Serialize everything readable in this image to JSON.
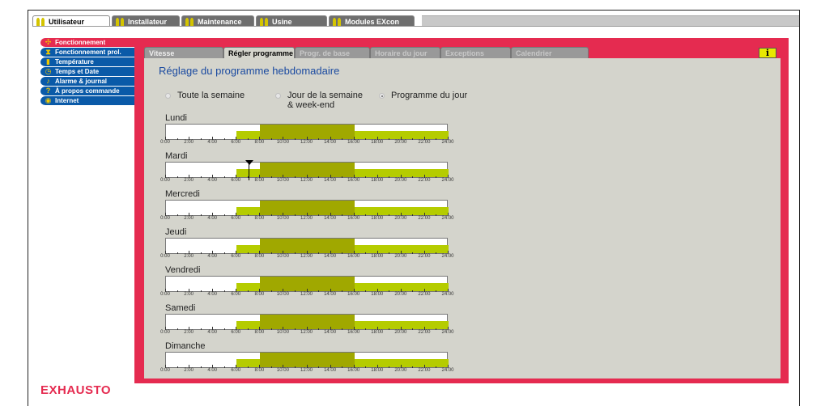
{
  "top_tabs": [
    {
      "label": "Utilisateur",
      "active": true,
      "width": 96,
      "icon": "user-icon"
    },
    {
      "label": "Installateur",
      "active": false,
      "width": 84,
      "icon": "installer-icon"
    },
    {
      "label": "Maintenance",
      "active": false,
      "width": 90,
      "icon": "maintenance-icon"
    },
    {
      "label": "Usine",
      "active": false,
      "width": 88,
      "icon": "factory-icon"
    },
    {
      "label": "Modules EXcon",
      "active": false,
      "width": 106,
      "icon": "modules-icon"
    }
  ],
  "nav": [
    {
      "label": "Fonctionnement",
      "active": true,
      "icon": "fan-icon"
    },
    {
      "label": "Fonctionnement prol.",
      "active": false,
      "icon": "hourglass-icon"
    },
    {
      "label": "Température",
      "active": false,
      "icon": "thermometer-icon"
    },
    {
      "label": "Temps et Date",
      "active": false,
      "icon": "clock-icon"
    },
    {
      "label": "Alarme & journal",
      "active": false,
      "icon": "bell-icon"
    },
    {
      "label": "À propos commande",
      "active": false,
      "icon": "question-icon"
    },
    {
      "label": "Internet",
      "active": false,
      "icon": "globe-icon"
    }
  ],
  "sub_tabs": [
    {
      "label": "Vitesse",
      "active": false,
      "enabled": true
    },
    {
      "label": "Régler programme",
      "active": true,
      "enabled": true
    },
    {
      "label": "Progr. de base",
      "active": false,
      "enabled": false
    },
    {
      "label": "Horaire du jour",
      "active": false,
      "enabled": false
    },
    {
      "label": "Exceptions",
      "active": false,
      "enabled": false
    },
    {
      "label": "Calendrier",
      "active": false,
      "enabled": false
    }
  ],
  "info_label": "i",
  "title": "Réglage du programme hebdomadaire",
  "radios": [
    {
      "label": "Toute la semaine",
      "label2": "",
      "checked": false
    },
    {
      "label": "Jour de la semaine",
      "label2": "& week-end",
      "checked": false
    },
    {
      "label": "Programme du jour",
      "label2": "",
      "checked": true
    }
  ],
  "colors": {
    "level1": "#b5cc00",
    "level2": "#a0a800",
    "accent": "#e52b50",
    "nav": "#0a5aa8"
  },
  "time_labels": [
    "0:00",
    "2:00",
    "4:00",
    "6:00",
    "8:00",
    "10:00",
    "12:00",
    "14:00",
    "16:00",
    "18:00",
    "20:00",
    "22:00",
    "24:00"
  ],
  "schedule_hours": [
    {
      "start": 6,
      "end": 8,
      "level": 1
    },
    {
      "start": 8,
      "end": 16,
      "level": 2
    },
    {
      "start": 16,
      "end": 24,
      "level": 1
    }
  ],
  "days": [
    "Lundi",
    "Mardi",
    "Mercredi",
    "Jeudi",
    "Vendredi",
    "Samedi",
    "Dimanche"
  ],
  "logo": "EXHAUSTO"
}
